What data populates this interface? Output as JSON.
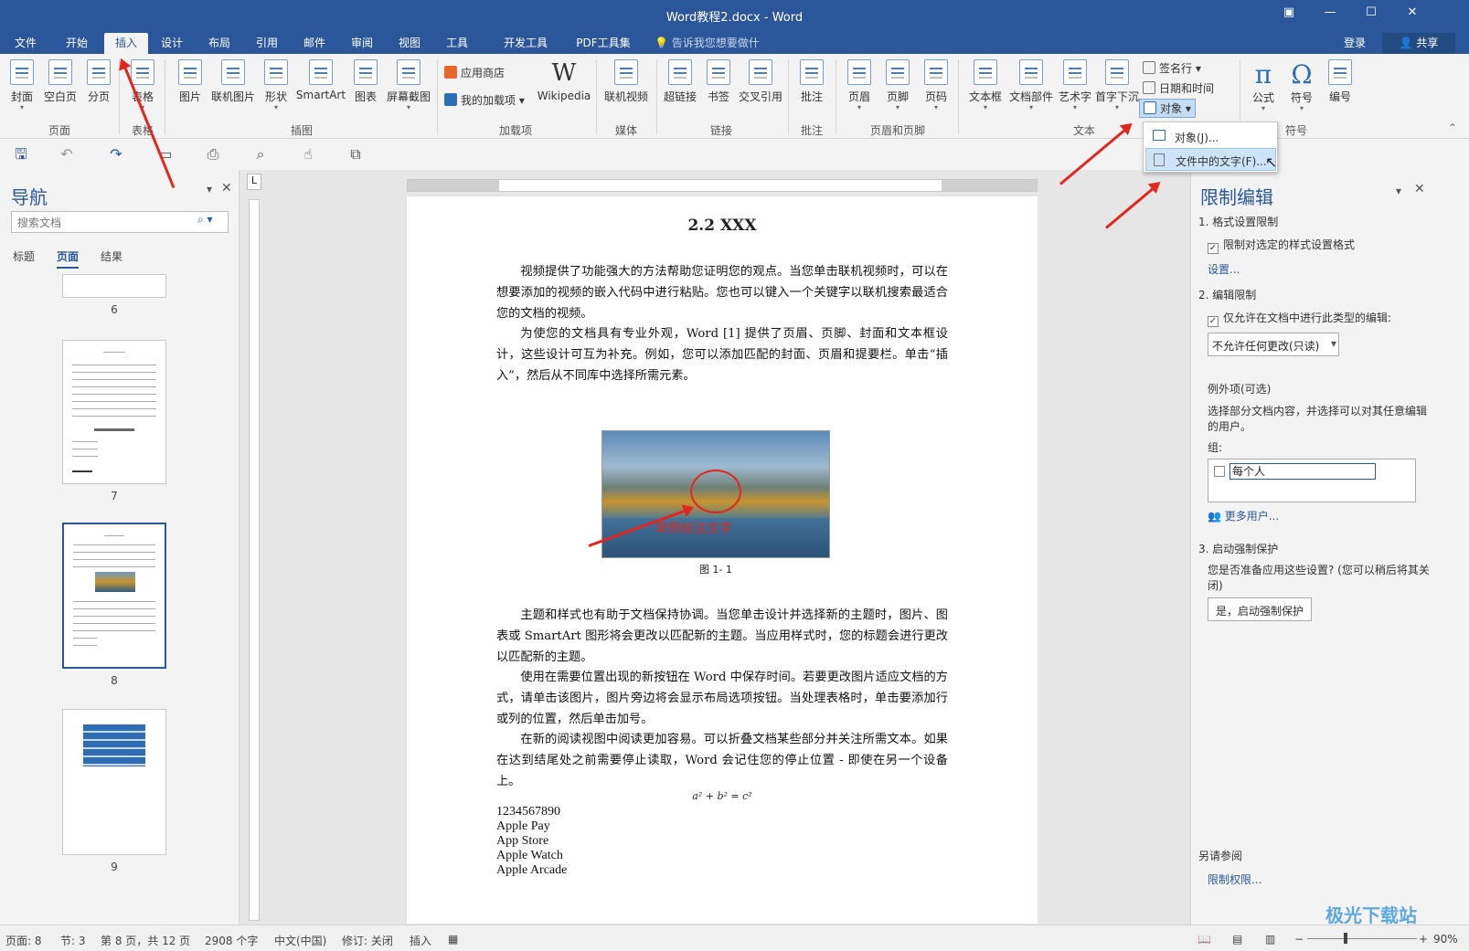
{
  "window": {
    "title": "Word教程2.docx - Word"
  },
  "tabs": [
    {
      "label": "文件"
    },
    {
      "label": "开始"
    },
    {
      "label": "插入"
    },
    {
      "label": "设计"
    },
    {
      "label": "布局"
    },
    {
      "label": "引用"
    },
    {
      "label": "邮件"
    },
    {
      "label": "审阅"
    },
    {
      "label": "视图"
    },
    {
      "label": "工具"
    },
    {
      "label": "开发工具"
    },
    {
      "label": "PDF工具集"
    }
  ],
  "tell_me": "告诉我您想要做什么...",
  "account": {
    "login": "登录",
    "share": "共享"
  },
  "ribbon": {
    "pages": {
      "cover": "封面",
      "blank": "空白页",
      "break": "分页",
      "group": "页面"
    },
    "tables": {
      "table": "表格",
      "group": "表格"
    },
    "illustrations": {
      "picture": "图片",
      "online_picture": "联机图片",
      "shapes": "形状",
      "smartart": "SmartArt",
      "chart": "图表",
      "screenshot": "屏幕截图",
      "group": "插图"
    },
    "addins": {
      "store": "应用商店",
      "my_addins": "我的加载项",
      "wikipedia": "Wikipedia",
      "group": "加载项"
    },
    "media": {
      "online_video": "联机视频",
      "group": "媒体"
    },
    "links": {
      "hyperlink": "超链接",
      "bookmark": "书签",
      "cross_ref": "交叉引用",
      "group": "链接"
    },
    "comments": {
      "comment": "批注",
      "group": "批注"
    },
    "header_footer": {
      "header": "页眉",
      "footer": "页脚",
      "page_number": "页码",
      "group": "页眉和页脚"
    },
    "text": {
      "textbox": "文本框",
      "quick_parts": "文档部件",
      "wordart": "艺术字",
      "dropcap": "首字下沉",
      "signature": "签名行",
      "datetime": "日期和时间",
      "object": "对象",
      "group": "文本"
    },
    "symbols": {
      "equation": "公式",
      "symbol": "符号",
      "number": "编号",
      "group": "符号"
    }
  },
  "object_menu": {
    "items": [
      {
        "label": "对象(J)..."
      },
      {
        "label": "文件中的文字(F)..."
      }
    ]
  },
  "nav": {
    "title": "导航",
    "search_placeholder": "搜索文档",
    "tabs": [
      {
        "label": "标题"
      },
      {
        "label": "页面"
      },
      {
        "label": "结果"
      }
    ],
    "pages": [
      {
        "num": "6"
      },
      {
        "num": "7"
      },
      {
        "num": "8"
      },
      {
        "num": "9"
      }
    ]
  },
  "document": {
    "heading": "2.2 XXX",
    "para1": "视频提供了功能强大的方法帮助您证明您的观点。当您单击联机视频时，可以在想要添加的视频的嵌入代码中进行粘贴。您也可以键入一个关键字以联机搜索最适合您的文档的视频。",
    "para2": "为使您的文档具有专业外观，Word [1] 提供了页眉、页脚、封面和文本框设计，这些设计可互为补充。例如，您可以添加匹配的封面、页眉和提要栏。单击“插入”，然后从不同库中选择所需元素。",
    "figure_annotation": "举例标注文字",
    "figure_caption": "图 1- 1",
    "para3": "主题和样式也有助于文档保持协调。当您单击设计并选择新的主题时，图片、图表或 SmartArt 图形将会更改以匹配新的主题。当应用样式时，您的标题会进行更改以匹配新的主题。",
    "para4": "使用在需要位置出现的新按钮在 Word 中保存时间。若要更改图片适应文档的方式，请单击该图片，图片旁边将会显示布局选项按钮。当处理表格时，单击要添加行或列的位置，然后单击加号。",
    "para5": "在新的阅读视图中阅读更加容易。可以折叠文档某些部分并关注所需文本。如果在达到结尾处之前需要停止读取，Word 会记住您的停止位置 - 即使在另一个设备上。",
    "equation": "a² + b² = c²",
    "lines": [
      "1234567890",
      "Apple Pay",
      "App Store",
      "Apple Watch",
      "Apple Arcade"
    ]
  },
  "restrict_pane": {
    "title": "限制编辑",
    "sec1": "1. 格式设置限制",
    "sec1_check": "限制对选定的样式设置格式",
    "sec1_link": "设置...",
    "sec2": "2. 编辑限制",
    "sec2_check": "仅允许在文档中进行此类型的编辑:",
    "sec2_select": "不允许任何更改(只读)",
    "exceptions": "例外项(可选)",
    "exceptions_desc": "选择部分文档内容，并选择可以对其任意编辑的用户。",
    "group_label": "组:",
    "everyone": "每个人",
    "more_users": "更多用户...",
    "sec3": "3. 启动强制保护",
    "sec3_desc": "您是否准备应用这些设置? (您可以稍后将其关闭)",
    "sec3_button": "是，启动强制保护",
    "see_also": "另请参阅",
    "permissions_link": "限制权限..."
  },
  "status": {
    "page": "页面: 8",
    "section": "节: 3",
    "page_of": "第 8 页，共 12 页",
    "words": "2908 个字",
    "lang": "中文(中国)",
    "track": "修订: 关闭",
    "insert": "插入",
    "zoom": "90%"
  },
  "watermark": "极光下载站"
}
